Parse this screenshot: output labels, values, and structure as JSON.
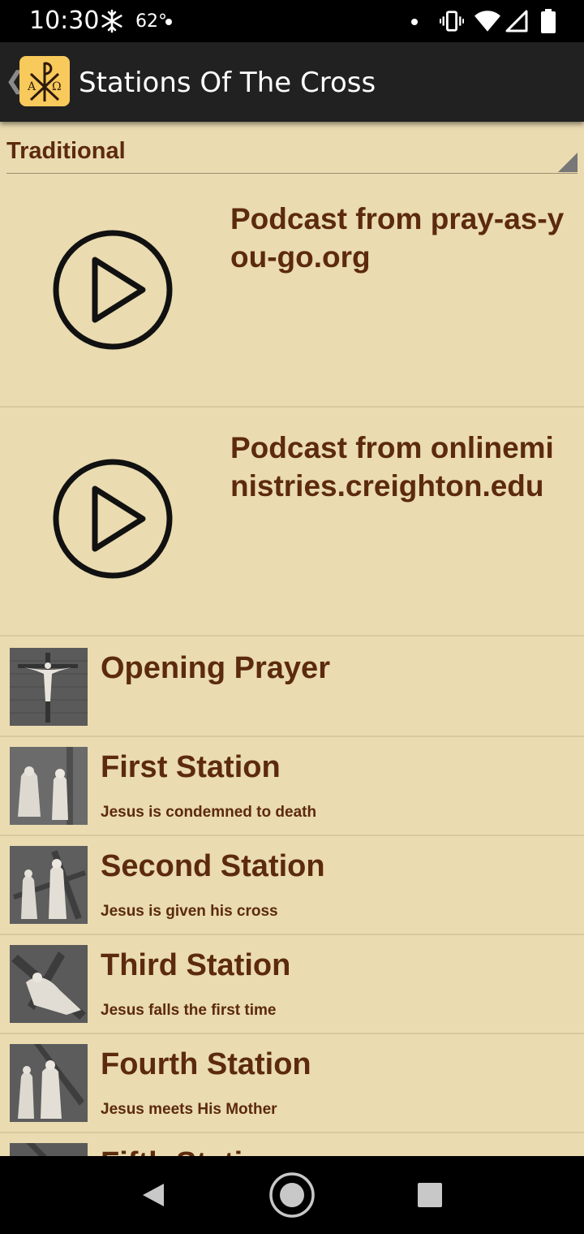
{
  "status_bar": {
    "time": "10:30",
    "temperature": "62°",
    "icons": [
      "snowflake-icon",
      "notification-dot",
      "vibrate-icon",
      "wifi-icon",
      "signal-icon",
      "battery-icon"
    ]
  },
  "app_bar": {
    "title": "Stations Of The Cross",
    "back_icon": "chevron-left-icon",
    "logo_icon": "chi-rho-alpha-omega-logo"
  },
  "spinner": {
    "selected": "Traditional"
  },
  "podcasts": [
    {
      "title": "Podcast from pray-as-you-go.org",
      "icon": "play-circle-icon"
    },
    {
      "title": "Podcast from onlineministries.creighton.edu",
      "icon": "play-circle-icon"
    }
  ],
  "stations": [
    {
      "title": "Opening Prayer",
      "subtitle": ""
    },
    {
      "title": "First Station",
      "subtitle": "Jesus is condemned to death"
    },
    {
      "title": "Second Station",
      "subtitle": "Jesus is given his cross"
    },
    {
      "title": "Third Station",
      "subtitle": "Jesus falls the first time"
    },
    {
      "title": "Fourth Station",
      "subtitle": "Jesus meets His Mother"
    },
    {
      "title": "Fifth Station",
      "subtitle": ""
    }
  ],
  "nav_bar": {
    "icons": [
      "back-triangle-icon",
      "home-circle-icon",
      "recents-square-icon"
    ]
  },
  "colors": {
    "background": "#eadbb0",
    "text": "#5c2a0e",
    "app_bar": "#212121",
    "logo": "#f8c95b"
  }
}
